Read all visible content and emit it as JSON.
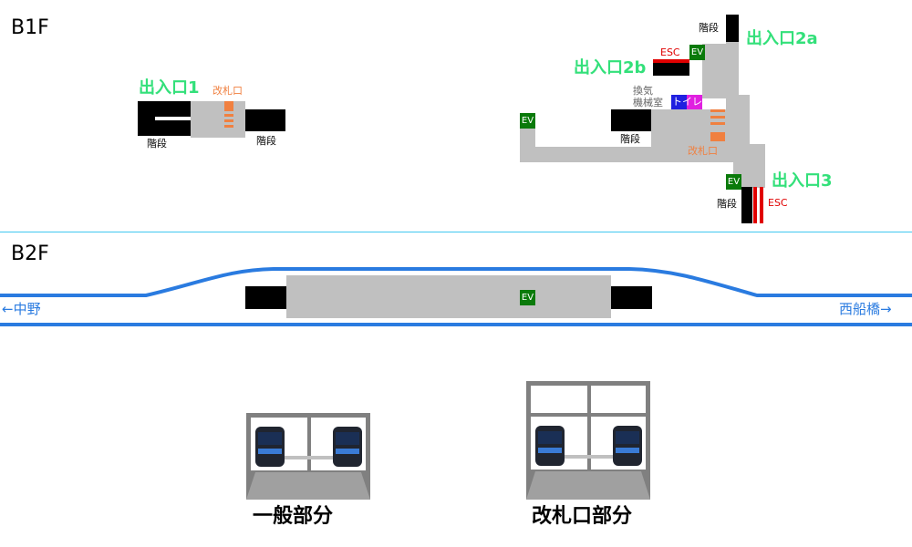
{
  "floors": {
    "b1": "B1F",
    "b2": "B2F"
  },
  "exits": {
    "exit1": "出入口1",
    "exit2a": "出入口2a",
    "exit2b": "出入口2b",
    "exit3": "出入口3"
  },
  "labels": {
    "stairs": "階段",
    "gate": "改札口",
    "esc": "ESC",
    "ev": "EV",
    "toilet": "トイレ",
    "machine_room": "換気\n機械室"
  },
  "directions": {
    "left": "←中野",
    "right": "西船橋→"
  },
  "captions": {
    "general": "一般部分",
    "gate_section": "改札口部分"
  },
  "colors": {
    "exit_text": "#33e07a",
    "gate": "#f08040",
    "esc": "#e00000",
    "ev": "#0a7a0a",
    "track": "#2a7be0",
    "toilet": "#2020e0"
  }
}
